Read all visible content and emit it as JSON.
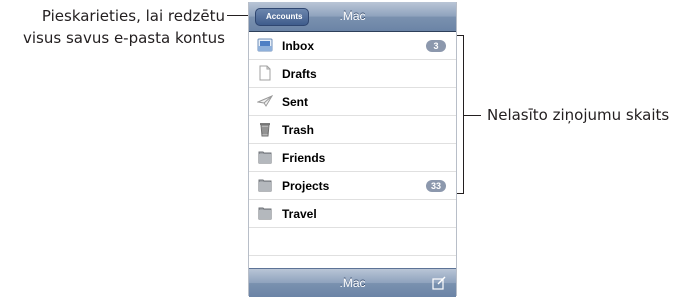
{
  "callouts": {
    "accounts_note_line1": "Pieskarieties, lai redzētu",
    "accounts_note_line2": "visus savus e-pasta kontus",
    "unread_note": "Nelasīto ziņojumu skaits"
  },
  "topbar": {
    "back_label": "Accounts",
    "title": ".Mac"
  },
  "mailboxes": [
    {
      "label": "Inbox",
      "icon": "inbox-icon",
      "unread": "3"
    },
    {
      "label": "Drafts",
      "icon": "drafts-icon",
      "unread": ""
    },
    {
      "label": "Sent",
      "icon": "sent-icon",
      "unread": ""
    },
    {
      "label": "Trash",
      "icon": "trash-icon",
      "unread": ""
    },
    {
      "label": "Friends",
      "icon": "folder-icon",
      "unread": ""
    },
    {
      "label": "Projects",
      "icon": "folder-icon",
      "unread": "33"
    },
    {
      "label": "Travel",
      "icon": "folder-icon",
      "unread": ""
    }
  ],
  "bottombar": {
    "title": ".Mac",
    "compose_icon": "compose-icon"
  },
  "colors": {
    "bar_blue": "#7a91af",
    "badge_gray": "#8c98ad",
    "folder_gray": "#8f9397"
  }
}
